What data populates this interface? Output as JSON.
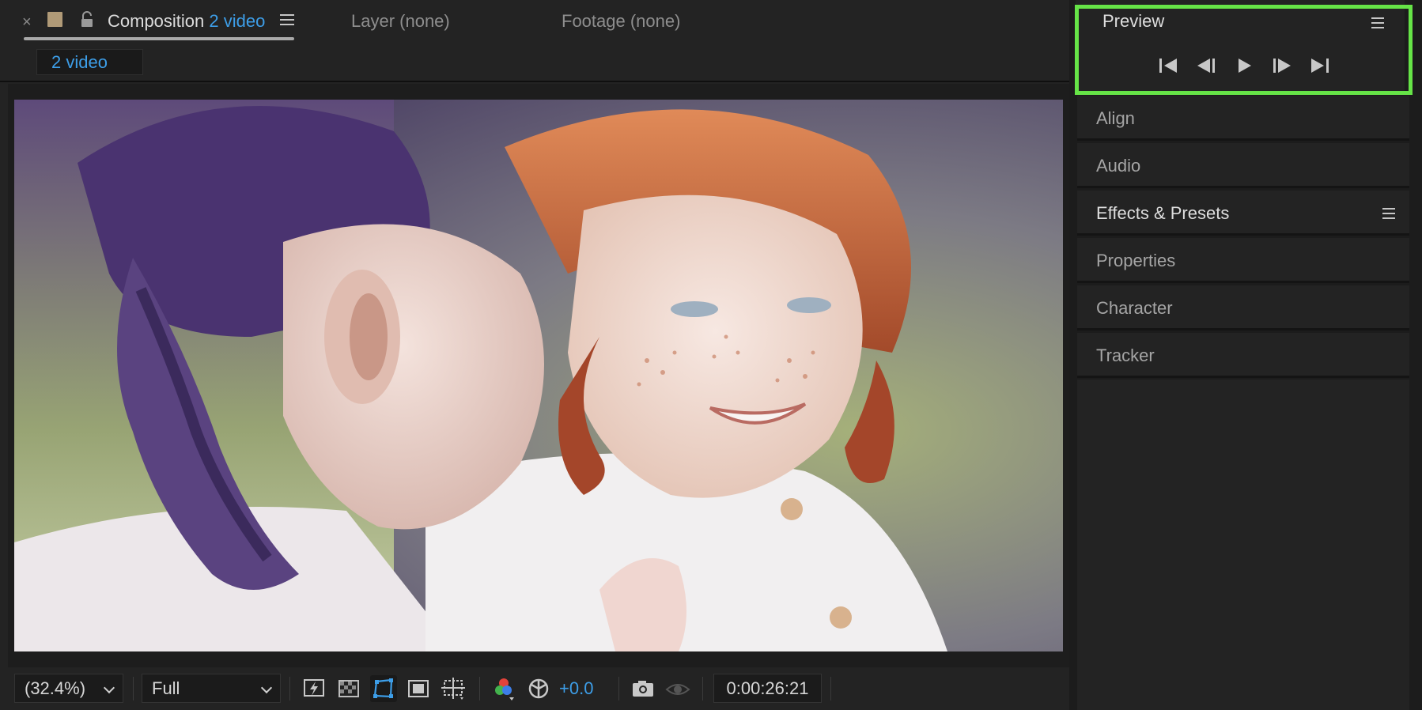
{
  "composition_panel": {
    "tabs": {
      "close": "×",
      "composition_label": "Composition",
      "composition_name": "2 video",
      "layer_tab": "Layer (none)",
      "footage_tab": "Footage (none)"
    },
    "breadcrumb": "2 video",
    "toolbar": {
      "zoom": "(32.4%)",
      "resolution": "Full",
      "exposure": "+0.0",
      "timecode": "0:00:26:21"
    }
  },
  "right_panels": {
    "preview": {
      "title": "Preview",
      "highlight_color": "#66e447"
    },
    "panels": [
      "Align",
      "Audio",
      "Effects & Presets",
      "Properties",
      "Character",
      "Tracker"
    ]
  },
  "colors": {
    "accent": "#3d9ee8",
    "swatch": "#b09a77",
    "panel_bg": "#232323"
  },
  "icons": [
    "close-icon",
    "lock-icon",
    "menu-icon",
    "first-frame-icon",
    "previous-frame-icon",
    "play-icon",
    "next-frame-icon",
    "last-frame-icon",
    "fast-previews-icon",
    "transparency-grid-icon",
    "mask-path-icon",
    "region-of-interest-icon",
    "guides-icon",
    "color-channels-icon",
    "exposure-reset-icon",
    "snapshot-icon",
    "show-snapshot-icon"
  ]
}
